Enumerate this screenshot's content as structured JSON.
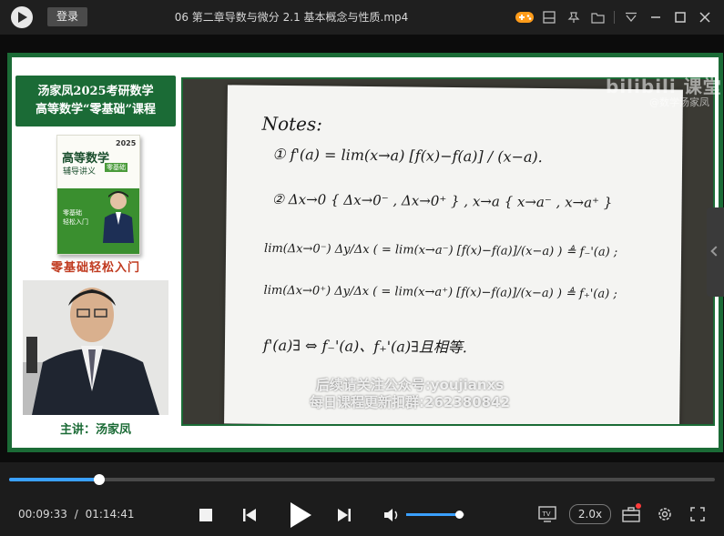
{
  "window": {
    "title": "06 第二章导数与微分 2.1 基本概念与性质.mp4",
    "login_label": "登录"
  },
  "promo": {
    "title_line1": "汤家凤2025考研数学",
    "title_line2": "高等数学“零基础”课程",
    "book_title": "高等数学",
    "book_sub": "辅导讲义",
    "book_badge": "零基础",
    "book_year": "2025",
    "book_line1": "零基础",
    "book_line2": "轻松入门",
    "tagline": "零基础轻松入门",
    "caption": "主讲：汤家凤"
  },
  "notes": {
    "heading": "Notes:",
    "line1": "① f'(a) = lim(x→a) [f(x)−f(a)] / (x−a).",
    "line2": "② Δx→0 { Δx→0⁻ , Δx→0⁺ } , x→a { x→a⁻ , x→a⁺ }",
    "line3": "lim(Δx→0⁻) Δy/Δx ( = lim(x→a⁻) [f(x)−f(a)]/(x−a) ) ≜ f₋'(a) ;",
    "line4": "lim(Δx→0⁺) Δy/Δx ( = lim(x→a⁺) [f(x)−f(a)]/(x−a) ) ≜ f₊'(a) ;",
    "line5": "f'(a)∃ ⇔ f₋'(a)、f₊'(a)∃且相等."
  },
  "watermark": {
    "brand": "bilibili 课堂",
    "handle": "@数学汤家凤"
  },
  "overlay": {
    "line1": "后续请关注公众号:youjianxs",
    "line2": "每日课程更新扣群:262380842"
  },
  "player": {
    "current_time": "00:09:33",
    "separator": "/",
    "total_time": "01:14:41",
    "progress": 0.128,
    "volume": 0.9,
    "speed_label": "2.0x"
  },
  "icons": {
    "titlebar": [
      "game-icon",
      "playlist-icon",
      "pin-icon",
      "folder-icon",
      "collapse-icon",
      "minimize-icon",
      "maximize-icon",
      "close-icon"
    ],
    "controls": [
      "stop-icon",
      "previous-icon",
      "play-icon",
      "next-icon",
      "volume-icon",
      "tv-cast-icon",
      "toolbox-icon",
      "settings-icon",
      "fullscreen-icon"
    ]
  },
  "colors": {
    "accent": "#3aa0ff",
    "frame_green": "#1b6b36",
    "promo_red": "#c03a1f"
  }
}
